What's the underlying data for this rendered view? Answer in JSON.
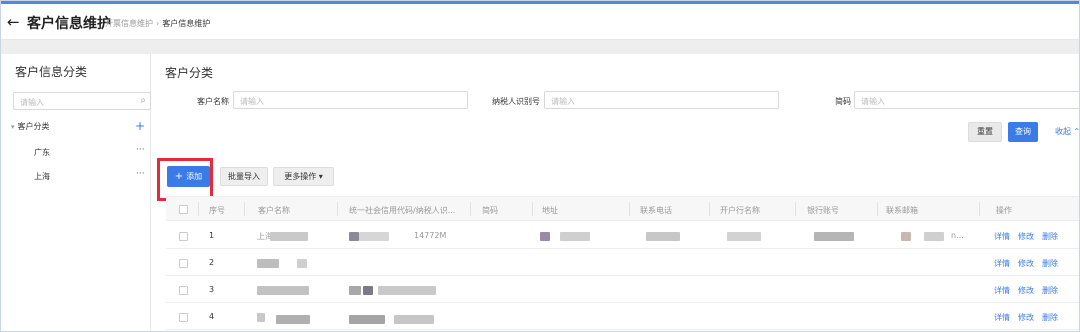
{
  "header": {
    "title": "客户信息维护",
    "breadcrumb": [
      "开票信息维护",
      "客户信息维护"
    ]
  },
  "sidebar": {
    "title": "客户信息分类",
    "search_placeholder": "请输入",
    "tree": {
      "root": "客户分类",
      "children": [
        "广东",
        "上海"
      ]
    }
  },
  "main": {
    "title": "客户分类",
    "filters": [
      {
        "label": "客户名称",
        "placeholder": "请输入"
      },
      {
        "label": "纳税人识别号",
        "placeholder": "请输入"
      },
      {
        "label": "简码",
        "placeholder": "请输入"
      }
    ],
    "buttons": {
      "reset": "重置",
      "query": "查询",
      "collapse": "收起",
      "add": "添加",
      "import": "批量导入",
      "more": "更多操作"
    }
  },
  "table": {
    "columns": [
      "序号",
      "客户名称",
      "统一社会信用代码/纳税人识...",
      "简码",
      "地址",
      "联系电话",
      "开户行名称",
      "银行账号",
      "联系邮箱",
      "操作"
    ],
    "rows": [
      {
        "no": "1",
        "name_partial": "上海",
        "code_partial": "14772M",
        "email_partial": "n..."
      },
      {
        "no": "2"
      },
      {
        "no": "3"
      },
      {
        "no": "4"
      }
    ],
    "row_actions": [
      "详情",
      "修改",
      "删除"
    ]
  },
  "colors": {
    "primary": "#3a7be8",
    "highlight": "#e52a3a"
  }
}
